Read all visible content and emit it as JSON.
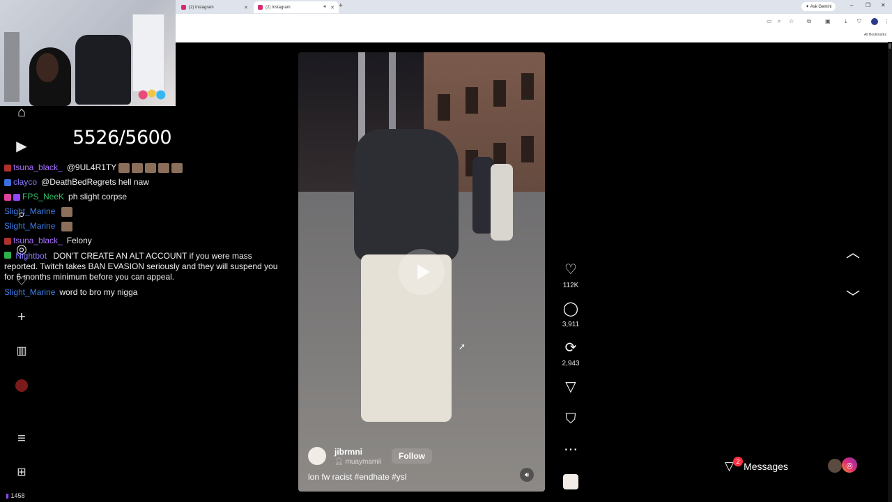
{
  "browser": {
    "tabs": [
      {
        "label": "(2) Instagram"
      },
      {
        "label": "(2) Instagram"
      }
    ],
    "ask_gemini": "Ask Gemini",
    "bookmarks_label": "All Bookmarks"
  },
  "stream": {
    "sub_count": "5526/5600",
    "counter": "1458"
  },
  "chat": [
    {
      "user": "tsuna_black_",
      "user_color": "#a970ff",
      "message": "@9UL4R1TY"
    },
    {
      "user": "clayco",
      "user_color": "#8a7dff",
      "message": "@DeathBedRegrets hell naw"
    },
    {
      "user": "FPS_NeeK",
      "user_color": "#34c26a",
      "message": "ph slight corpse"
    },
    {
      "user": "Slight_Marine",
      "user_color": "#3d7ee6",
      "message": ""
    },
    {
      "user": "Slight_Marine",
      "user_color": "#3d7ee6",
      "message": ""
    },
    {
      "user": "tsuna_black_",
      "user_color": "#a970ff",
      "message": "Felony"
    },
    {
      "user": "Nightbot",
      "user_color": "#8a7dff",
      "message": "DON'T CREATE AN ALT ACCOUNT if you were mass reported. Twitch takes BAN EVASION seriously and they will suspend you for 6 months minimum before you can appeal."
    },
    {
      "user": "Slight_Marine",
      "user_color": "#3d7ee6",
      "message": "word to bro my nigga"
    }
  ],
  "reel": {
    "username": "jibrmni",
    "audio": "muaymarnii",
    "follow_label": "Follow",
    "caption": "lon fw racist #endhate #ysl"
  },
  "actions": {
    "likes": "112K",
    "comments": "3,911",
    "reposts": "2,943"
  },
  "messages": {
    "label": "Messages",
    "unread": "2"
  },
  "icons": {
    "home": "home-icon",
    "reels": "reels-icon",
    "search": "search-icon",
    "explore": "explore-icon",
    "notifications": "heart-icon",
    "create": "plus-icon",
    "insights": "dashboard-icon",
    "menu": "hamburger-icon",
    "apps": "apps-grid-icon"
  },
  "colors": {
    "background": "#000000",
    "ig_gradient": [
      "#f58529",
      "#dd2a7b",
      "#8134af"
    ],
    "badge_red": "#ff3040"
  }
}
